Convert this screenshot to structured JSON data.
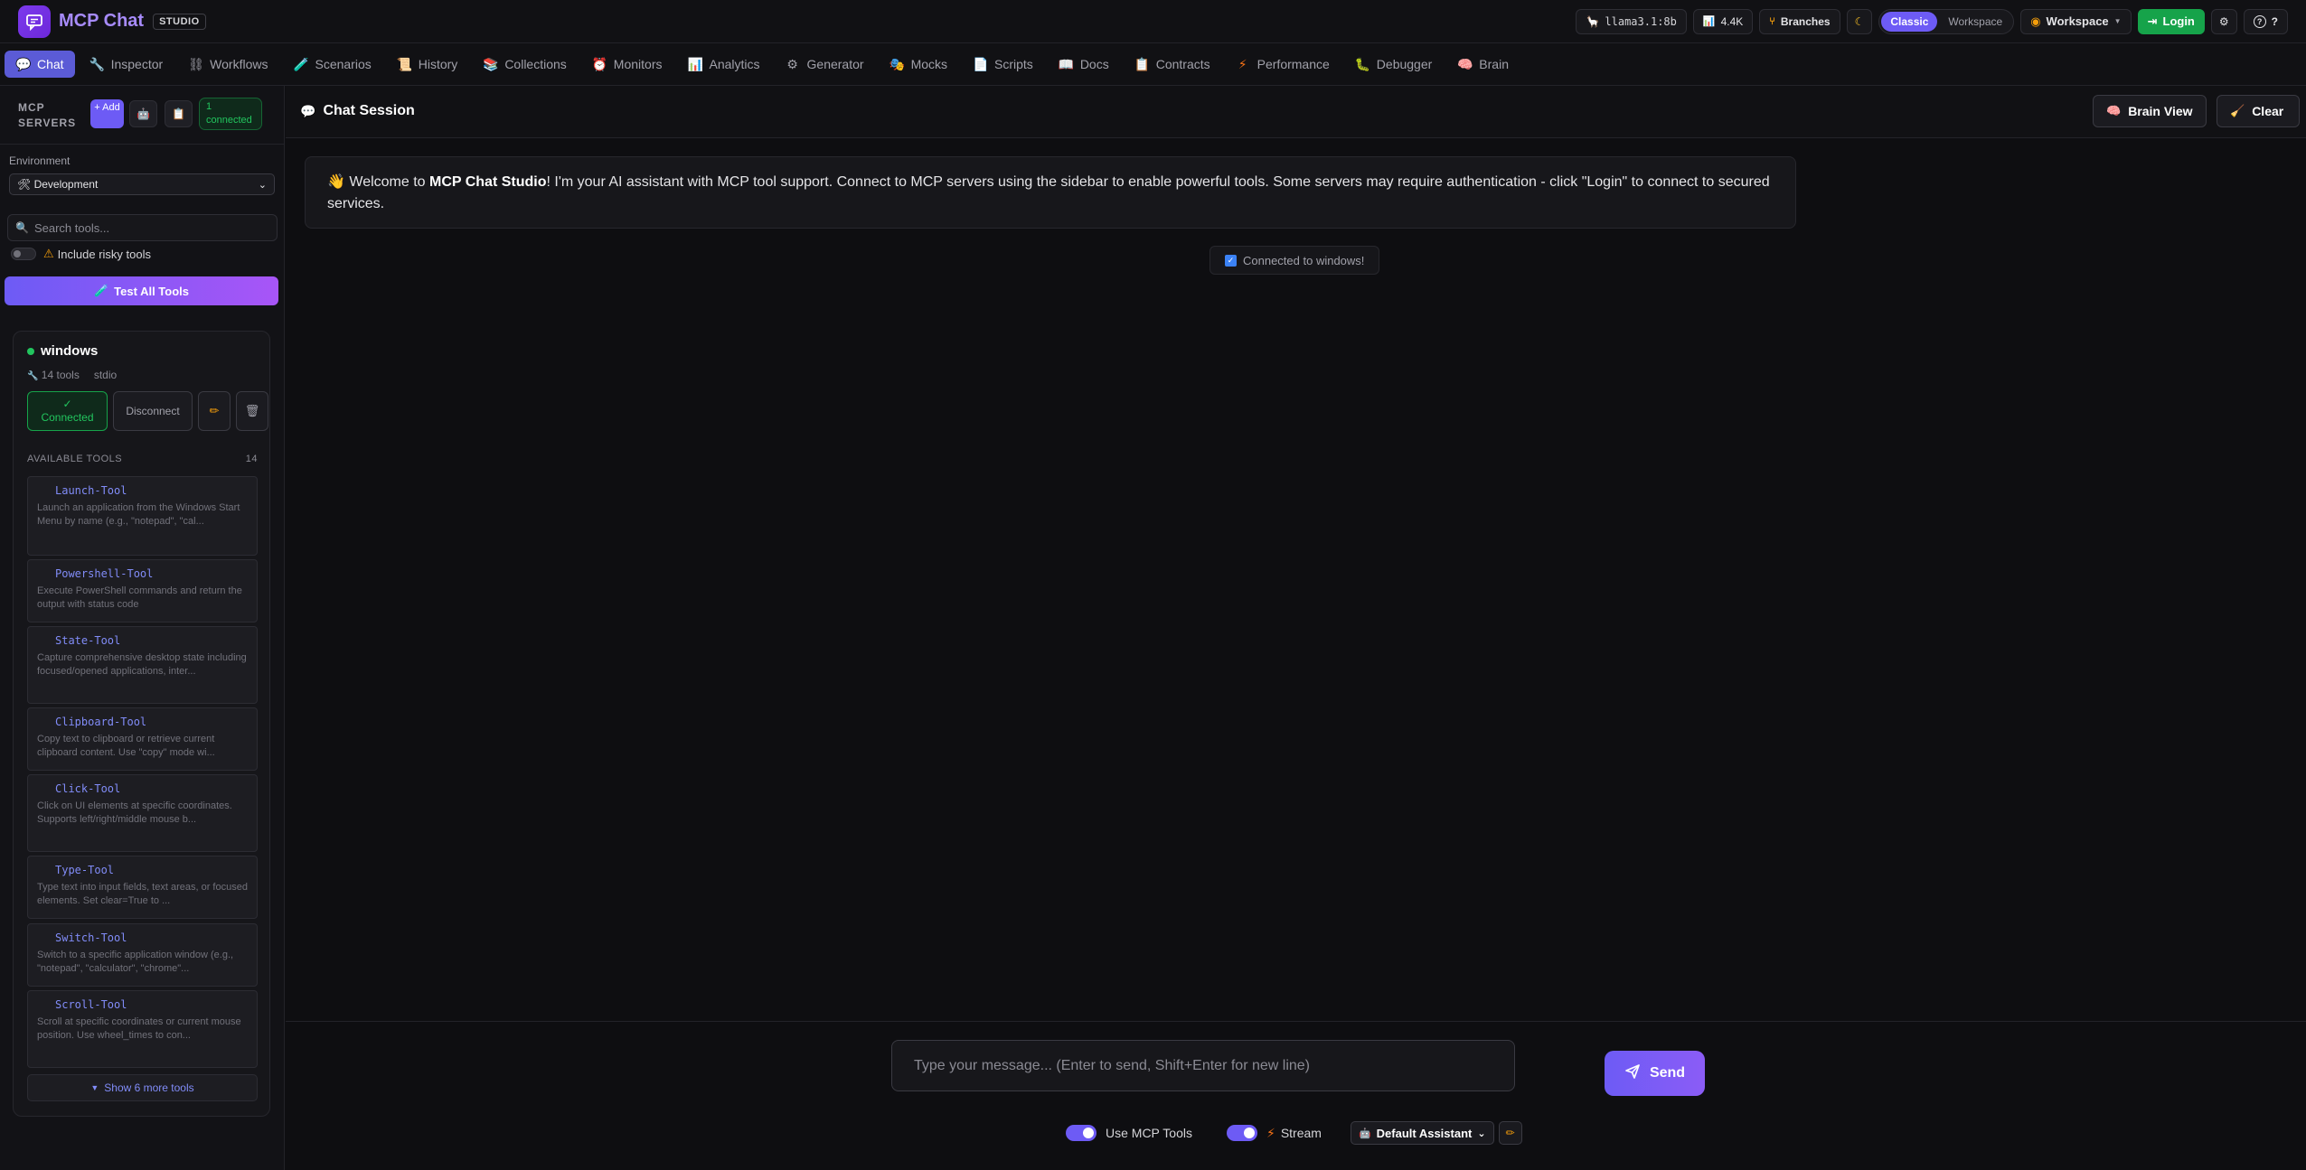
{
  "header": {
    "app_title": "MCP Chat",
    "badge": "STUDIO",
    "model": "llama3.1:8b",
    "tokens": "4.4K",
    "branches_label": "Branches",
    "layout_modes": [
      "Classic",
      "Workspace"
    ],
    "active_layout": "Classic",
    "workspace_label": "Workspace",
    "login_label": "Login",
    "help_label": "?"
  },
  "nav": {
    "items": [
      {
        "label": "Chat",
        "icon": "💬"
      },
      {
        "label": "Inspector",
        "icon": "🔧"
      },
      {
        "label": "Workflows",
        "icon": "⛓"
      },
      {
        "label": "Scenarios",
        "icon": "🧪"
      },
      {
        "label": "History",
        "icon": "📜"
      },
      {
        "label": "Collections",
        "icon": "📚"
      },
      {
        "label": "Monitors",
        "icon": "⏰"
      },
      {
        "label": "Analytics",
        "icon": "📊"
      },
      {
        "label": "Generator",
        "icon": "⚙"
      },
      {
        "label": "Mocks",
        "icon": "🎭"
      },
      {
        "label": "Scripts",
        "icon": "📄"
      },
      {
        "label": "Docs",
        "icon": "📖"
      },
      {
        "label": "Contracts",
        "icon": "📋"
      },
      {
        "label": "Performance",
        "icon": "⚡"
      },
      {
        "label": "Debugger",
        "icon": "🐛"
      },
      {
        "label": "Brain",
        "icon": "🧠"
      }
    ],
    "active": "Chat"
  },
  "sidebar": {
    "title": "MCP SERVERS",
    "add_label": "+ Add",
    "connected_count": "1 connected",
    "env_label": "Environment",
    "env_value": "🛠 Development",
    "search_placeholder": "Search tools...",
    "risky_label": "Include risky tools",
    "test_all_label": "Test All Tools",
    "server": {
      "name": "windows",
      "tools_count": "14 tools",
      "transport": "stdio",
      "connected_label": "Connected",
      "disconnect_label": "Disconnect",
      "available_label": "AVAILABLE TOOLS",
      "available_count": "14",
      "tools": [
        {
          "name": "Launch-Tool",
          "desc": "Launch an application from the Windows Start Menu by name (e.g., \"notepad\", \"cal..."
        },
        {
          "name": "Powershell-Tool",
          "desc": "Execute PowerShell commands and return the output with status code"
        },
        {
          "name": "State-Tool",
          "desc": "Capture comprehensive desktop state including focused/opened applications, inter..."
        },
        {
          "name": "Clipboard-Tool",
          "desc": "Copy text to clipboard or retrieve current clipboard content. Use \"copy\" mode wi..."
        },
        {
          "name": "Click-Tool",
          "desc": "Click on UI elements at specific coordinates. Supports left/right/middle mouse b..."
        },
        {
          "name": "Type-Tool",
          "desc": "Type text into input fields, text areas, or focused elements. Set clear=True to ..."
        },
        {
          "name": "Switch-Tool",
          "desc": "Switch to a specific application window (e.g., \"notepad\", \"calculator\", \"chrome\"..."
        },
        {
          "name": "Scroll-Tool",
          "desc": "Scroll at specific coordinates or current mouse position. Use wheel_times to con..."
        }
      ],
      "show_more_label": "Show 6 more tools"
    }
  },
  "chat": {
    "title": "Chat Session",
    "brain_view_label": "Brain View",
    "clear_label": "Clear",
    "welcome_pre": "Welcome to ",
    "welcome_brand": "MCP Chat Studio",
    "welcome_post": "! I'm your AI assistant with MCP tool support. Connect to MCP servers using the sidebar to enable powerful tools. Some servers may require authentication - click \"Login\" to connect to secured services.",
    "system_message": "Connected to windows!",
    "input_placeholder": "Type your message... (Enter to send, Shift+Enter for new line)",
    "send_label": "Send",
    "use_mcp_label": "Use MCP Tools",
    "stream_label": "Stream",
    "assistant_label": "Default Assistant"
  }
}
